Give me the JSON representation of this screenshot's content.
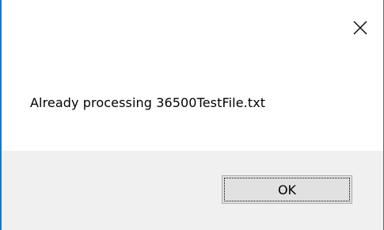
{
  "dialog": {
    "message": "Already processing 36500TestFile.txt",
    "ok_label": "OK",
    "close_icon": "close-icon"
  },
  "colors": {
    "border": "#1979ca",
    "footer_background": "#f0f0f0",
    "button_background": "#e1e1e1"
  }
}
